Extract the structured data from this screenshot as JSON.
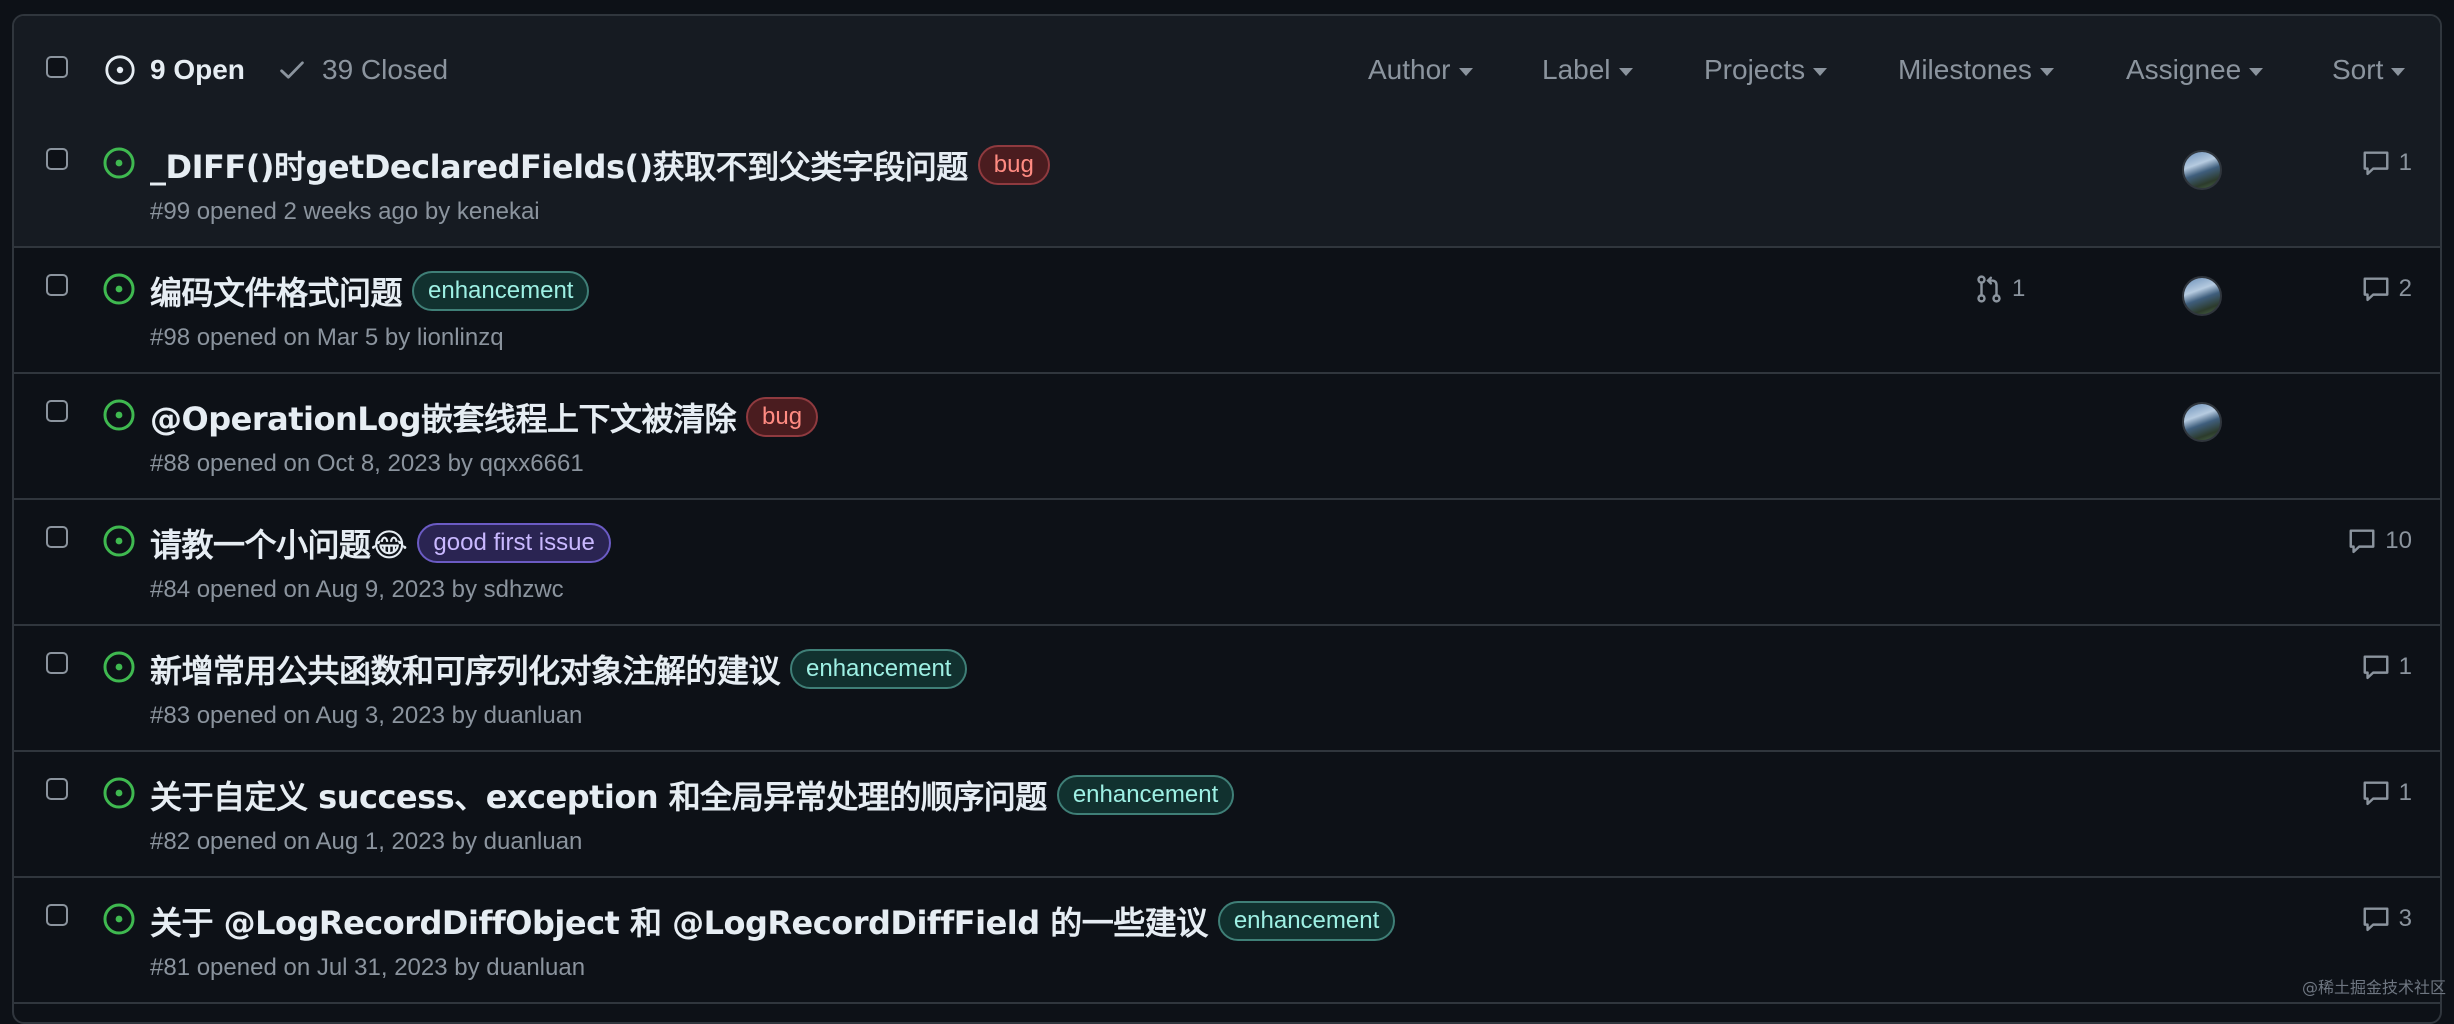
{
  "header": {
    "open_count": "9 Open",
    "closed_count": "39 Closed",
    "filters": [
      "Author",
      "Label",
      "Projects",
      "Milestones",
      "Assignee",
      "Sort"
    ]
  },
  "colors": {
    "open_icon": "#3fb950",
    "bug": {
      "text": "#ff8b82",
      "bg": "#4a1c1f",
      "border": "#8f3a3f"
    },
    "enhancement": {
      "text": "#9ef0e4",
      "bg": "#11312f",
      "border": "#3f7f77"
    },
    "good_first_issue": {
      "text": "#c9b8ff",
      "bg": "#2a2452",
      "border": "#6b5bc4"
    }
  },
  "issues": [
    {
      "title": "_DIFF()时getDeclaredFields()获取不到父类字段问题",
      "label": "bug",
      "label_type": "bug",
      "meta": "#99 opened 2 weeks ago by kenekai",
      "linked_prs": "",
      "has_assignee": true,
      "comments": "1"
    },
    {
      "title": "编码文件格式问题",
      "label": "enhancement",
      "label_type": "enhancement",
      "meta": "#98 opened on Mar 5 by lionlinzq",
      "linked_prs": "1",
      "has_assignee": true,
      "comments": "2"
    },
    {
      "title": "@OperationLog嵌套线程上下文被清除",
      "label": "bug",
      "label_type": "bug",
      "meta": "#88 opened on Oct 8, 2023 by qqxx6661",
      "linked_prs": "",
      "has_assignee": true,
      "comments": ""
    },
    {
      "title": "请教一个小问题😂",
      "label": "good first issue",
      "label_type": "good_first_issue",
      "meta": "#84 opened on Aug 9, 2023 by sdhzwc",
      "linked_prs": "",
      "has_assignee": false,
      "comments": "10"
    },
    {
      "title": "新增常用公共函数和可序列化对象注解的建议",
      "label": "enhancement",
      "label_type": "enhancement",
      "meta": "#83 opened on Aug 3, 2023 by duanluan",
      "linked_prs": "",
      "has_assignee": false,
      "comments": "1"
    },
    {
      "title": "关于自定义 success、exception 和全局异常处理的顺序问题",
      "label": "enhancement",
      "label_type": "enhancement",
      "meta": "#82 opened on Aug 1, 2023 by duanluan",
      "linked_prs": "",
      "has_assignee": false,
      "comments": "1"
    },
    {
      "title": "关于 @LogRecordDiffObject 和 @LogRecordDiffField 的一些建议",
      "label": "enhancement",
      "label_type": "enhancement",
      "meta": "#81 opened on Jul 31, 2023 by duanluan",
      "linked_prs": "",
      "has_assignee": false,
      "comments": "3"
    }
  ],
  "watermark": "@稀土掘金技术社区"
}
